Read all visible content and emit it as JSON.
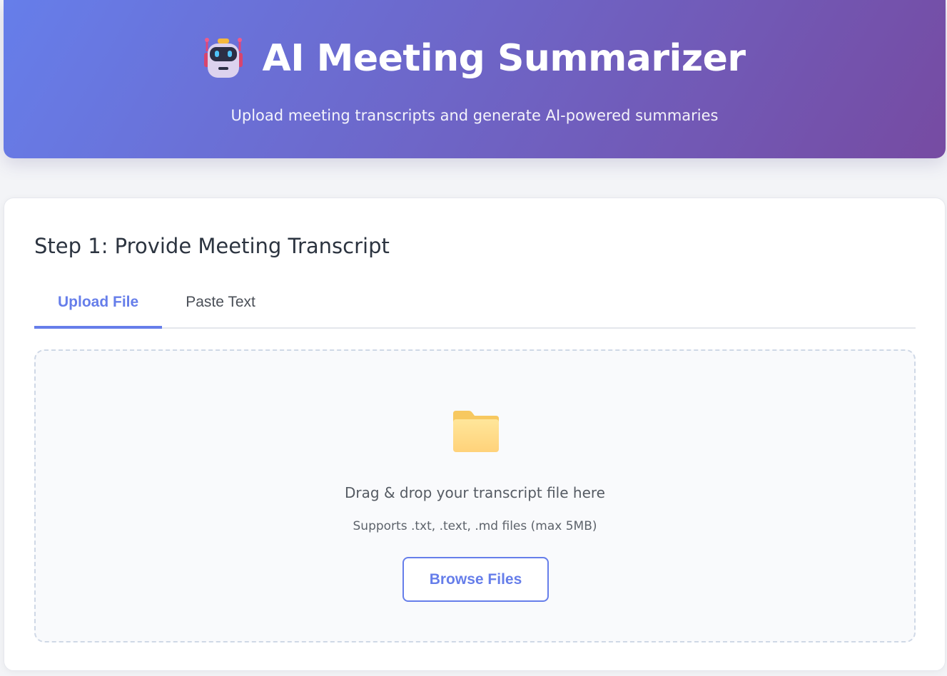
{
  "header": {
    "icon": "robot-icon",
    "title": "AI Meeting Summarizer",
    "subtitle": "Upload meeting transcripts and generate AI-powered summaries",
    "gradient": [
      "#667eea",
      "#764ba2"
    ]
  },
  "step1": {
    "title": "Step 1: Provide Meeting Transcript",
    "tabs": [
      {
        "label": "Upload File",
        "active": true
      },
      {
        "label": "Paste Text",
        "active": false
      }
    ],
    "dropzone": {
      "icon": "folder-icon",
      "text": "Drag & drop your transcript file here",
      "hint": "Supports .txt, .text, .md files (max 5MB)",
      "button_label": "Browse Files"
    }
  },
  "colors": {
    "accent": "#667eea",
    "heading": "#2c3440"
  }
}
